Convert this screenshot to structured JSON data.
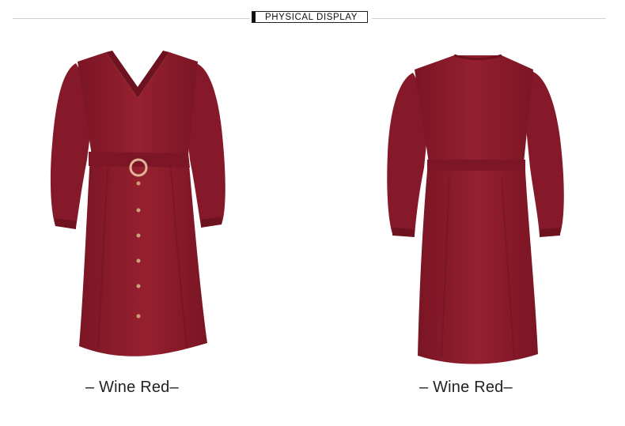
{
  "header": {
    "title": "PHYSICAL DISPLAY"
  },
  "products": [
    {
      "view": "front",
      "caption": "– Wine Red–"
    },
    {
      "view": "back",
      "caption": "– Wine Red–"
    }
  ],
  "colors": {
    "dress": "#8e1a2a",
    "dress_shadow": "#6e1220",
    "buckle": "#e2b49a",
    "button": "#c9a27a"
  }
}
